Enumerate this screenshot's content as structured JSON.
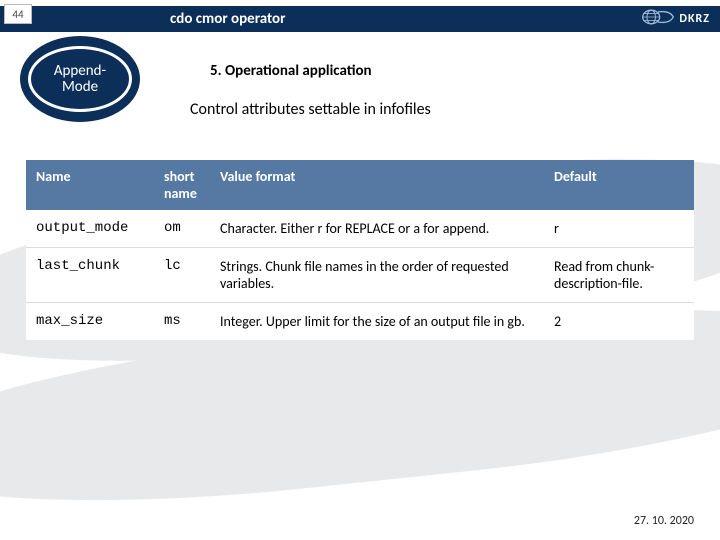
{
  "slide_number": "44",
  "topbar_title": "cdo cmor operator",
  "logo_text": "DKRZ",
  "badge_text": "Append-Mode",
  "section_title": "5. Operational application",
  "subtitle": "Control attributes settable in infofiles",
  "table": {
    "headers": {
      "name": "Name",
      "short": "short name",
      "value": "Value format",
      "default": "Default"
    },
    "rows": [
      {
        "name": "output_mode",
        "short": "om",
        "value": "Character. Either r for REPLACE or a for append.",
        "default": "r"
      },
      {
        "name": "last_chunk",
        "short": "lc",
        "value": "Strings. Chunk file names in the order of requested variables.",
        "default": "Read from chunk-description-file."
      },
      {
        "name": "max_size",
        "short": "ms",
        "value": "Integer. Upper limit for the size of an output file in gb.",
        "default": "2"
      }
    ]
  },
  "date": "27. 10. 2020"
}
